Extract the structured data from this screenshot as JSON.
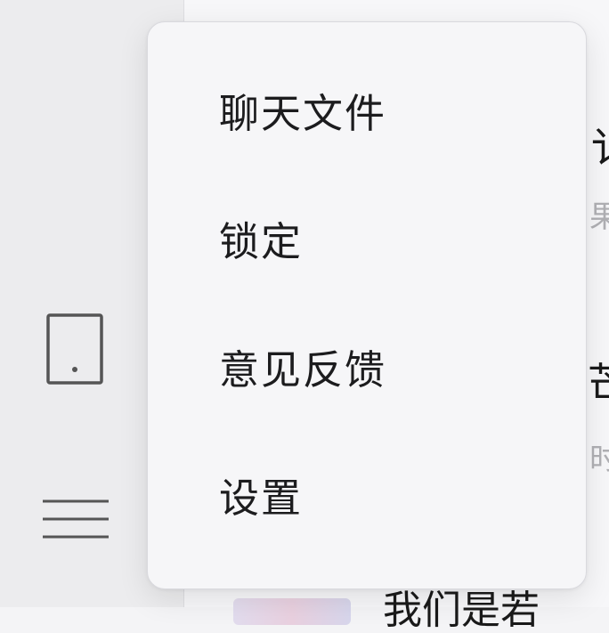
{
  "sidebar": {
    "icons": [
      "tablet-icon",
      "hamburger-menu-icon"
    ]
  },
  "background_list": {
    "fragments": [
      "讠",
      "果",
      "芒",
      "时"
    ],
    "bottom_text": "我们是若"
  },
  "menu": {
    "items": [
      {
        "label": "聊天文件",
        "name": "chat-files"
      },
      {
        "label": "锁定",
        "name": "lock"
      },
      {
        "label": "意见反馈",
        "name": "feedback"
      },
      {
        "label": "设置",
        "name": "settings"
      }
    ]
  },
  "colors": {
    "sidebar_bg": "#ececee",
    "popup_bg": "#f6f6f8",
    "text": "#1c1c1e",
    "icon": "#555555"
  }
}
